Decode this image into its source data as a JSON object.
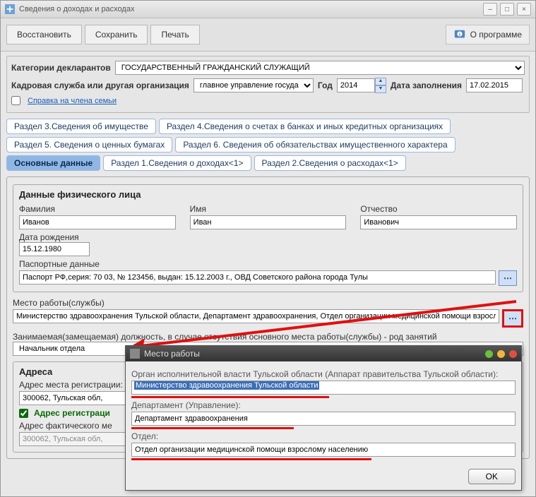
{
  "window": {
    "title": "Сведения о доходах и расходах"
  },
  "toolbar": {
    "restore": "Восстановить",
    "save": "Сохранить",
    "print": "Печать",
    "about": "О программе"
  },
  "top": {
    "cat_label": "Категории декларантов",
    "cat_value": "ГОСУДАРСТВЕННЫЙ ГРАЖДАНСКИЙ СЛУЖАЩИЙ",
    "org_label": "Кадровая служба или другая организация",
    "org_value": "главное управление госуда",
    "year_label": "Год",
    "year_value": "2014",
    "date_label": "Дата заполнения",
    "date_value": "17.02.2015",
    "family_ref": "Справка на члена семьи"
  },
  "tabs": {
    "t3": "Раздел 3.Сведения об имуществе",
    "t4": "Раздел 4.Сведения о счетах в банках и иных кредитных организациях",
    "t5": "Раздел 5. Сведения о ценных бумагах",
    "t6": "Раздел 6. Сведения об обязательствах имущественного характера",
    "t0": "Основные данные",
    "t1": "Раздел 1.Сведения о доходах<1>",
    "t2": "Раздел 2.Сведения о расходах<1>"
  },
  "person": {
    "group_title": "Данные физического лица",
    "l_fam": "Фамилия",
    "v_fam": "Иванов",
    "l_name": "Имя",
    "v_name": "Иван",
    "l_otch": "Отчество",
    "v_otch": "Иванович",
    "l_dob": "Дата рождения",
    "v_dob": "15.12.1980",
    "l_pass": "Паспортные данные",
    "v_pass": "Паспорт РФ,серия: 70 03, № 123456, выдан: 15.12.2003 г., ОВД Советского района города Тулы",
    "l_work": "Место работы(службы)",
    "v_work": "Министерство здравоохранения Тульской области, Департамент здравоохранения, Отдел организации медицинской помощи взросло",
    "l_pos": "Занимаемая(замещаемая) должность, в случае отсутствия основного места работы(службы) - род занятий",
    "v_pos": "Начальник отдела"
  },
  "addr": {
    "title": "Адреса",
    "l_reg": "Адрес места регистрации:",
    "v_reg": "300062, Тульская обл, ",
    "chk": "Адрес регистраци",
    "l_fact": "Адрес фактического ме",
    "v_fact": "300062, Тульская обл, "
  },
  "modal": {
    "title": "Место работы",
    "l_org": "Орган исполнительной власти Тульской области (Аппарат правительства Тульской области):",
    "v_org": "Министерство здравоохранения Тульской области",
    "l_dep": "Департамент (Управление):",
    "v_dep": "Департамент здравоохранения",
    "l_otd": "Отдел:",
    "v_otd": "Отдел организации медицинской помощи взрослому населению",
    "ok": "OK"
  }
}
